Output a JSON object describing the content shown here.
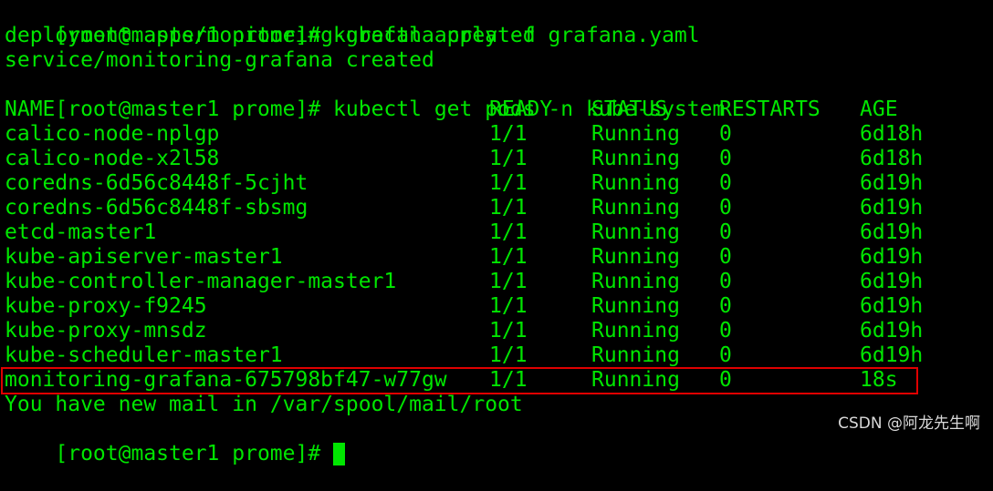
{
  "terminal": {
    "text_color": "#00e600",
    "background_color": "#000000",
    "highlight_color": "#e00000",
    "commands": [
      {
        "prompt": "[root@master1 prome]#",
        "command": "kubectl apply -f grafana.yaml"
      },
      {
        "prompt": "[root@master1 prome]#",
        "command": "kubectl get pods -n kube-system"
      }
    ],
    "apply_output": [
      "deployment.apps/monitoring-grafana created",
      "service/monitoring-grafana created"
    ],
    "table": {
      "headers": [
        "NAME",
        "READY",
        "STATUS",
        "RESTARTS",
        "AGE"
      ],
      "rows": [
        [
          "calico-node-nplgp",
          "1/1",
          "Running",
          "0",
          "6d18h"
        ],
        [
          "calico-node-x2l58",
          "1/1",
          "Running",
          "0",
          "6d18h"
        ],
        [
          "coredns-6d56c8448f-5cjht",
          "1/1",
          "Running",
          "0",
          "6d19h"
        ],
        [
          "coredns-6d56c8448f-sbsmg",
          "1/1",
          "Running",
          "0",
          "6d19h"
        ],
        [
          "etcd-master1",
          "1/1",
          "Running",
          "0",
          "6d19h"
        ],
        [
          "kube-apiserver-master1",
          "1/1",
          "Running",
          "0",
          "6d19h"
        ],
        [
          "kube-controller-manager-master1",
          "1/1",
          "Running",
          "0",
          "6d19h"
        ],
        [
          "kube-proxy-f9245",
          "1/1",
          "Running",
          "0",
          "6d19h"
        ],
        [
          "kube-proxy-mnsdz",
          "1/1",
          "Running",
          "0",
          "6d19h"
        ],
        [
          "kube-scheduler-master1",
          "1/1",
          "Running",
          "0",
          "6d19h"
        ],
        [
          "monitoring-grafana-675798bf47-w77gw",
          "1/1",
          "Running",
          "0",
          "18s"
        ]
      ]
    },
    "mail_notice": "You have new mail in /var/spool/mail/root",
    "final_prompt": "[root@master1 prome]#"
  },
  "watermark": "CSDN @阿龙先生啊"
}
